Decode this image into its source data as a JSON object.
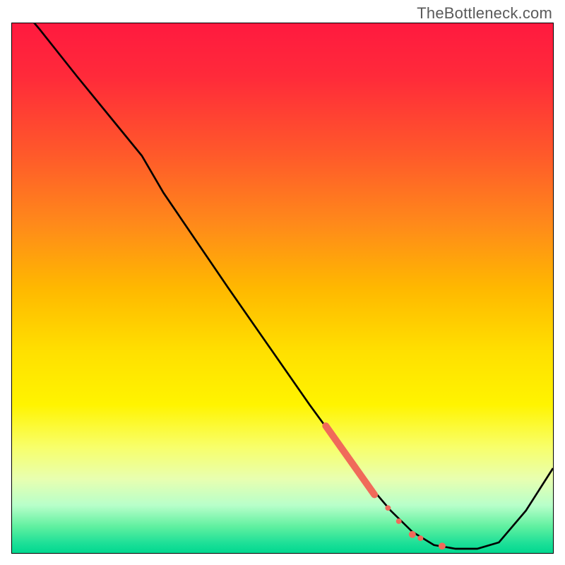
{
  "watermark": "TheBottleneck.com",
  "chart_data": {
    "type": "line",
    "title": "",
    "xlabel": "",
    "ylabel": "",
    "xlim": [
      0,
      100
    ],
    "ylim": [
      0,
      100
    ],
    "gradient_stops": [
      {
        "pos": 0,
        "color": "#ff1a3f"
      },
      {
        "pos": 10,
        "color": "#ff2a3a"
      },
      {
        "pos": 25,
        "color": "#ff5a2a"
      },
      {
        "pos": 38,
        "color": "#ff8a1a"
      },
      {
        "pos": 50,
        "color": "#ffb800"
      },
      {
        "pos": 62,
        "color": "#ffe000"
      },
      {
        "pos": 72,
        "color": "#fff400"
      },
      {
        "pos": 80,
        "color": "#f8ff6a"
      },
      {
        "pos": 86,
        "color": "#e8ffb0"
      },
      {
        "pos": 91,
        "color": "#b8ffca"
      },
      {
        "pos": 95,
        "color": "#60f0a0"
      },
      {
        "pos": 98,
        "color": "#20e098"
      },
      {
        "pos": 100,
        "color": "#00d890"
      }
    ],
    "series": [
      {
        "name": "bottleneck-curve",
        "color": "#000000",
        "stroke_width": 2,
        "points": [
          {
            "x": 0,
            "y": 105
          },
          {
            "x": 5,
            "y": 99
          },
          {
            "x": 12,
            "y": 90
          },
          {
            "x": 20,
            "y": 80
          },
          {
            "x": 24,
            "y": 75
          },
          {
            "x": 28,
            "y": 68
          },
          {
            "x": 40,
            "y": 50
          },
          {
            "x": 55,
            "y": 28
          },
          {
            "x": 65,
            "y": 14
          },
          {
            "x": 70,
            "y": 8
          },
          {
            "x": 74,
            "y": 4
          },
          {
            "x": 78,
            "y": 1.5
          },
          {
            "x": 82,
            "y": 0.8
          },
          {
            "x": 86,
            "y": 0.8
          },
          {
            "x": 90,
            "y": 2
          },
          {
            "x": 95,
            "y": 8
          },
          {
            "x": 100,
            "y": 16
          }
        ]
      }
    ],
    "markers": {
      "name": "highlight-segment",
      "color": "#f06a5a",
      "thick_segment": {
        "x1": 58,
        "y1": 24,
        "x2": 67,
        "y2": 11,
        "width": 10
      },
      "dots": [
        {
          "x": 69.5,
          "y": 8.5,
          "r": 4
        },
        {
          "x": 71.5,
          "y": 6.0,
          "r": 4
        },
        {
          "x": 74.0,
          "y": 3.5,
          "r": 5
        },
        {
          "x": 75.5,
          "y": 2.8,
          "r": 4
        },
        {
          "x": 79.5,
          "y": 1.3,
          "r": 5
        }
      ]
    }
  }
}
